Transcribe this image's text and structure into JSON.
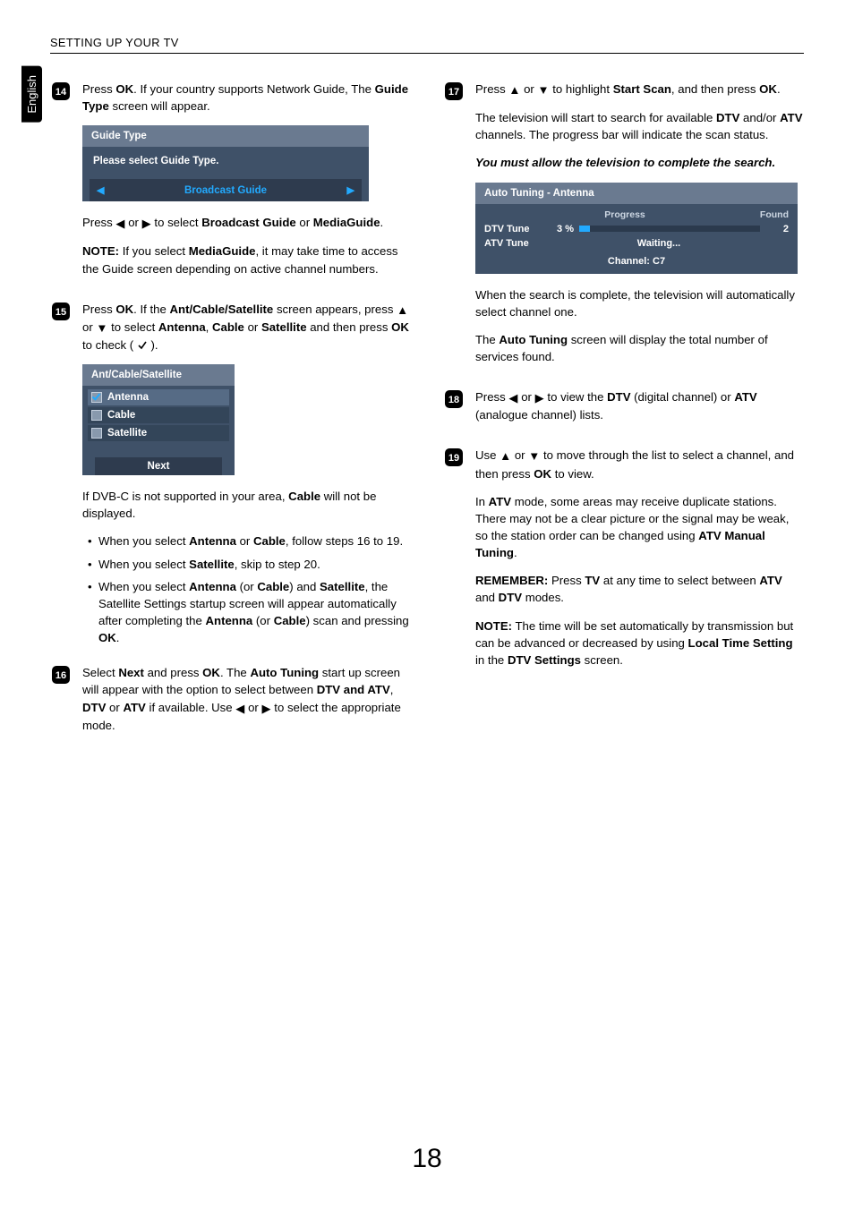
{
  "header": {
    "section_title": "SETTING UP YOUR TV"
  },
  "lang_tab": "English",
  "page_number": "18",
  "icons": {
    "tri_left": "◀",
    "tri_right": "▶",
    "tri_up": "▲",
    "tri_down": "▼"
  },
  "steps": {
    "14": {
      "p1_a": "Press ",
      "p1_b": "OK",
      "p1_c": ". If your country supports Network Guide, The ",
      "p1_d": "Guide Type",
      "p1_e": " screen will appear.",
      "panel": {
        "title": "Guide Type",
        "prompt": "Please select Guide Type.",
        "option": "Broadcast Guide"
      },
      "p2_a": "Press ",
      "p2_b": " or ",
      "p2_c": " to select ",
      "p2_d": "Broadcast Guide",
      "p2_e": " or ",
      "p2_f": "MediaGuide",
      "p2_g": ".",
      "note_a": "NOTE:",
      "note_b": " If you select ",
      "note_c": "MediaGuide",
      "note_d": ", it may take time to access the Guide screen depending on active channel numbers."
    },
    "15": {
      "p1_a": "Press ",
      "p1_b": "OK",
      "p1_c": ". If the ",
      "p1_d": "Ant/Cable/Satellite",
      "p1_e": " screen appears, press ",
      "p1_f": " or ",
      "p1_g": " to select ",
      "p1_h": "Antenna",
      "p1_i": ", ",
      "p1_j": "Cable",
      "p1_k": " or ",
      "p1_l": "Satellite",
      "p1_m": " and then press ",
      "p1_n": "OK",
      "p1_o": " to check ( ",
      "panel": {
        "title": "Ant/Cable/Satellite",
        "rows": [
          "Antenna",
          "Cable",
          "Satellite"
        ],
        "next": "Next"
      },
      "p2_a": "If DVB-C is not supported in your area, ",
      "p2_b": "Cable",
      "p2_c": " will not be displayed.",
      "li1_a": "When you select ",
      "li1_b": "Antenna",
      "li1_c": " or ",
      "li1_d": "Cable",
      "li1_e": ", follow steps 16 to 19.",
      "li2_a": "When you select ",
      "li2_b": "Satellite",
      "li2_c": ", skip to step 20.",
      "li3_a": "When you select ",
      "li3_b": "Antenna",
      "li3_c": " (or ",
      "li3_d": "Cable",
      "li3_e": ") and ",
      "li3_f": "Satellite",
      "li3_g": ", the Satellite Settings startup screen will appear automatically after completing the ",
      "li3_h": "Antenna",
      "li3_i": " (or ",
      "li3_j": "Cable",
      "li3_k": ") scan and pressing ",
      "li3_l": "OK",
      "li3_m": "."
    },
    "16": {
      "p1_a": "Select ",
      "p1_b": "Next",
      "p1_c": " and press ",
      "p1_d": "OK",
      "p1_e": ". The ",
      "p1_f": "Auto Tuning",
      "p1_g": " start up screen will appear with the option to select between ",
      "p1_h": "DTV and ATV",
      "p1_i": ", ",
      "p1_j": "DTV",
      "p1_k": " or ",
      "p1_l": "ATV",
      "p1_m": " if available. Use ",
      "p1_n": " or ",
      "p1_o": " to select the appropriate mode."
    },
    "17": {
      "p1_a": "Press ",
      "p1_b": " or ",
      "p1_c": " to highlight ",
      "p1_d": "Start Scan",
      "p1_e": ", and then press ",
      "p1_f": "OK",
      "p1_g": ".",
      "p2_a": "The television will start to search for available ",
      "p2_b": "DTV",
      "p2_c": " and/or ",
      "p2_d": "ATV",
      "p2_e": " channels. The progress bar will indicate the scan status.",
      "p3": "You must allow the television to complete the search.",
      "panel": {
        "title": "Auto Tuning - Antenna",
        "col_progress": "Progress",
        "col_found": "Found",
        "dtv_label": "DTV Tune",
        "dtv_pct": "3 %",
        "dtv_found": "2",
        "atv_label": "ATV Tune",
        "atv_wait": "Waiting...",
        "channel": "Channel: C7"
      },
      "p4": "When the search is complete, the television will automatically select channel one.",
      "p5_a": "The ",
      "p5_b": "Auto Tuning",
      "p5_c": " screen will display the total number of services found."
    },
    "18": {
      "p1_a": "Press ",
      "p1_b": " or ",
      "p1_c": " to view the ",
      "p1_d": "DTV",
      "p1_e": " (digital channel) or ",
      "p1_f": "ATV",
      "p1_g": " (analogue channel) lists."
    },
    "19": {
      "p1_a": "Use ",
      "p1_b": " or ",
      "p1_c": " to move through the list to select a channel, and then press ",
      "p1_d": "OK",
      "p1_e": " to view.",
      "p2_a": "In ",
      "p2_b": "ATV",
      "p2_c": " mode, some areas may receive duplicate stations. There may not be a clear picture or the signal may be weak, so the station order can be changed using ",
      "p2_d": "ATV Manual Tuning",
      "p2_e": ".",
      "p3_a": "REMEMBER:",
      "p3_b": " Press ",
      "p3_c": "TV",
      "p3_d": " at any time to select between ",
      "p3_e": "ATV",
      "p3_f": " and ",
      "p3_g": "DTV",
      "p3_h": " modes.",
      "p4_a": "NOTE:",
      "p4_b": " The time will be set automatically by transmission but can be advanced or decreased by using ",
      "p4_c": "Local Time Setting",
      "p4_d": " in the ",
      "p4_e": "DTV Settings",
      "p4_f": " screen."
    }
  },
  "chart_data": {
    "type": "bar",
    "title": "Auto Tuning - Antenna progress",
    "series": [
      {
        "name": "DTV Tune",
        "progress_percent": 3,
        "found": 2
      },
      {
        "name": "ATV Tune",
        "progress_percent": null,
        "status": "Waiting...",
        "found": null
      }
    ],
    "channel": "C7",
    "xlabel": "",
    "ylabel": "Progress (%)",
    "ylim": [
      0,
      100
    ]
  }
}
